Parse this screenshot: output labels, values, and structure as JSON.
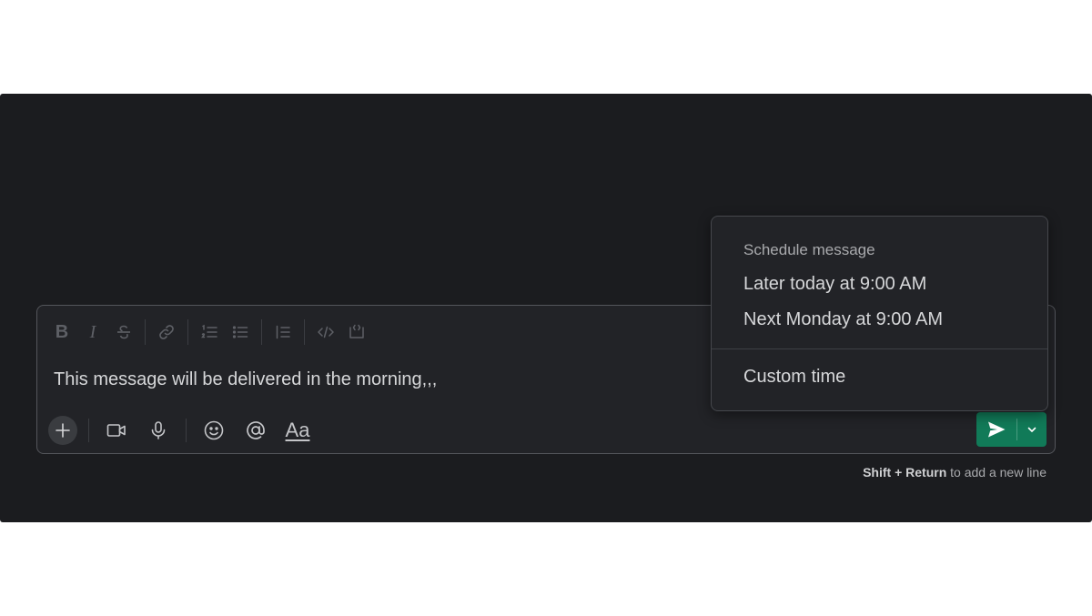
{
  "composer": {
    "message_text": "This message will be delivered in the morning,,,",
    "format_toolbar": {
      "bold_label": "B",
      "italic_label": "I"
    },
    "bottom_toolbar": {
      "format_label": "Aa"
    }
  },
  "hint": {
    "shortcut": "Shift + Return",
    "suffix": " to add a new line"
  },
  "schedule_menu": {
    "header": "Schedule message",
    "items": [
      {
        "label": "Later today at 9:00 AM"
      },
      {
        "label": "Next Monday at 9:00 AM"
      },
      {
        "label": "Custom time"
      }
    ]
  },
  "colors": {
    "panel_background": "#1b1c1f",
    "send_button": "#117a58"
  }
}
